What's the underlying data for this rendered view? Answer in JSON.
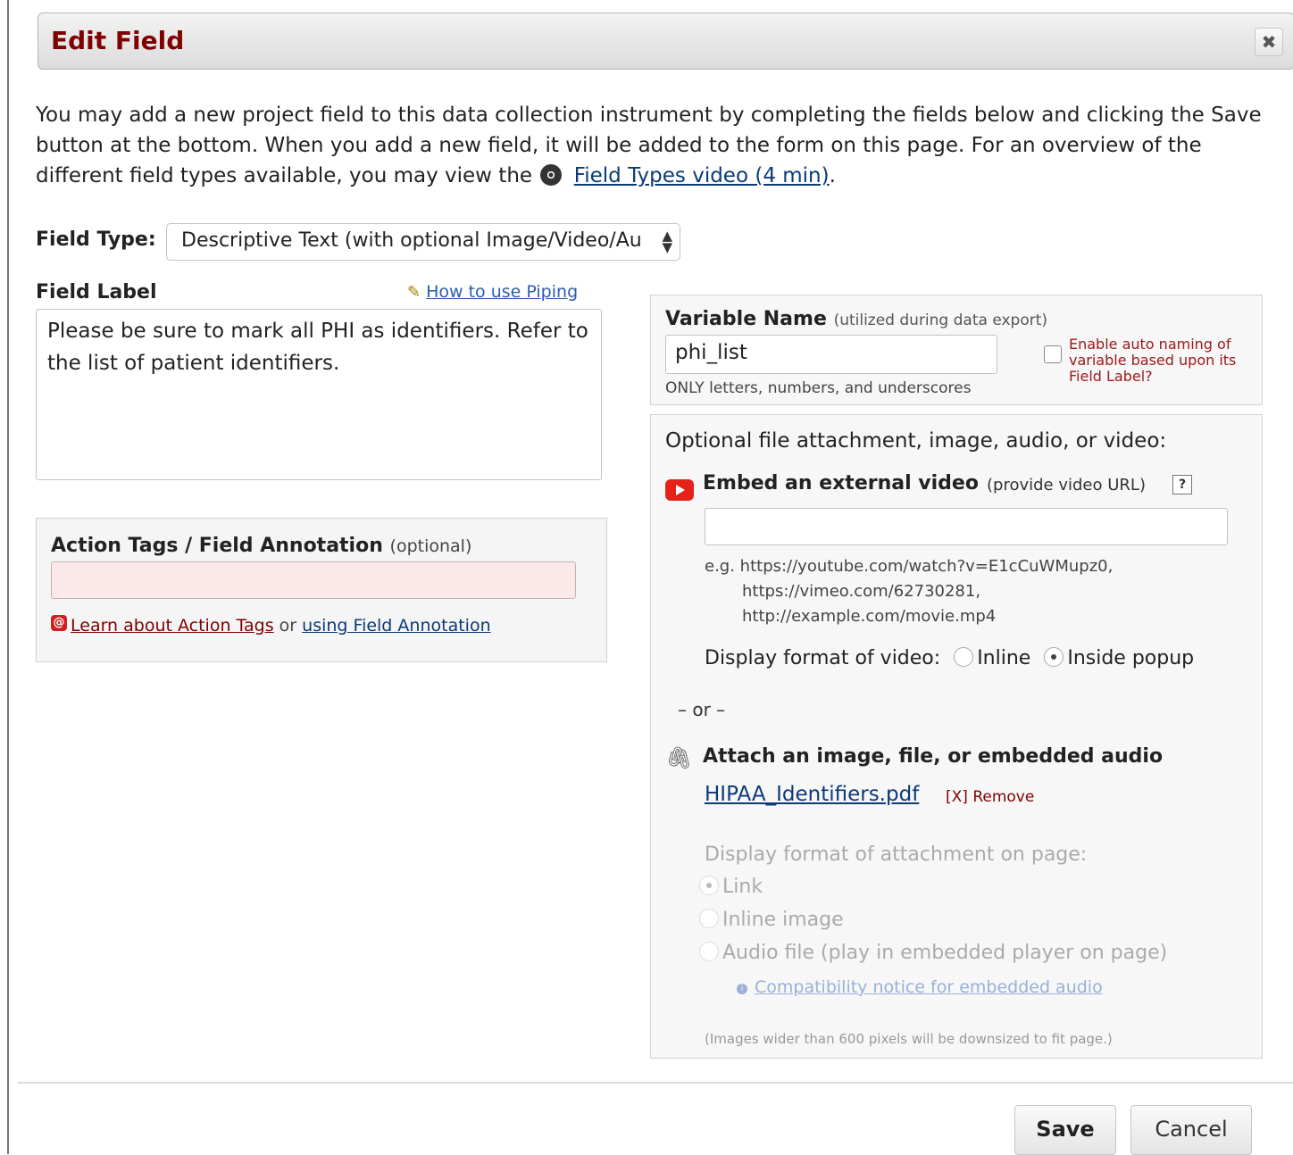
{
  "dialog": {
    "title": "Edit Field",
    "close_label": "✖"
  },
  "intro": {
    "text_before": "You may add a new project field to this data collection instrument by completing the fields below and clicking the Save button at the bottom. When you add a new field, it will be added to the form on this page. For an overview of the different field types available, you may view the",
    "video_link": "Field Types video (4 min)",
    "text_after": "."
  },
  "field_type": {
    "label": "Field Type:",
    "selected": "Descriptive Text (with optional Image/Video/Au"
  },
  "field_label": {
    "heading": "Field Label",
    "piping_link": "How to use Piping",
    "value": "Please be sure to mark all PHI as identifiers. Refer to the list of patient identifiers."
  },
  "action_tags": {
    "title": "Action Tags / Field Annotation",
    "optional": "(optional)",
    "value": "",
    "learn_link": "Learn about Action Tags",
    "or_text": "or",
    "annotation_link": "using Field Annotation"
  },
  "variable": {
    "title": "Variable Name",
    "hint": "(utilized during data export)",
    "value": "phi_list",
    "note": "ONLY letters, numbers, and underscores",
    "auto_name_label": "Enable auto naming of variable based upon its Field Label?"
  },
  "attachment": {
    "heading": "Optional file attachment, image, audio, or video:",
    "embed_title": "Embed an external video",
    "embed_hint": "(provide video URL)",
    "help_label": "?",
    "video_url": "",
    "examples": [
      "e.g. https://youtube.com/watch?v=E1cCuWMupz0,",
      "https://vimeo.com/62730281,",
      "http://example.com/movie.mp4"
    ],
    "display_format_label": "Display format of video:",
    "display_options": [
      "Inline",
      "Inside popup"
    ],
    "or_divider": "– or –",
    "attach_title": "Attach an image, file, or embedded audio",
    "file_name": "HIPAA_Identifiers.pdf",
    "remove_label": "[X] Remove",
    "attach_format_label": "Display format of attachment on page:",
    "attach_options": [
      "Link",
      "Inline image",
      "Audio file (play in embedded player on page)"
    ],
    "compat_link": "Compatibility notice for embedded audio",
    "image_note": "(Images wider than 600 pixels will be downsized to fit page.)"
  },
  "buttons": {
    "save": "Save",
    "cancel": "Cancel"
  }
}
